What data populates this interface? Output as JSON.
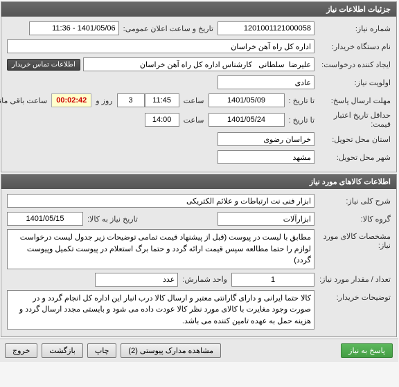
{
  "panel1": {
    "title": "جزئیات اطلاعات نیاز",
    "need_number_label": "شماره نیاز:",
    "need_number": "1201001121000058",
    "announce_label": "تاریخ و ساعت اعلان عمومی:",
    "announce_value": "1401/05/06 - 11:36",
    "buyer_label": "نام دستگاه خریدار:",
    "buyer_value": "اداره کل راه آهن خراسان",
    "requester_label": "ایجاد کننده درخواست:",
    "requester_value": "علیرضا  سلطانی   کارشناس اداره کل راه آهن خراسان",
    "contact_btn": "اطلاعات تماس خریدار",
    "priority_label": "اولویت نیاز:",
    "priority_value": "عادی",
    "deadline_label": "مهلت ارسال پاسخ:",
    "to_date_label": "تا تاریخ :",
    "deadline_date": "1401/05/09",
    "time_label": "ساعت",
    "deadline_time": "11:45",
    "days_remaining": "3",
    "days_and_label": "روز و",
    "countdown": "00:02:42",
    "hours_remaining_label": "ساعت باقی مانده",
    "price_validity_label": "حداقل تاریخ اعتبار قیمت:",
    "price_validity_date": "1401/05/24",
    "price_validity_time": "14:00",
    "province_label": "استان محل تحویل:",
    "province_value": "خراسان رضوی",
    "city_label": "شهر محل تحویل:",
    "city_value": "مشهد"
  },
  "panel2": {
    "title": "اطلاعات کالاهای مورد نیاز",
    "desc_label": "شرح کلی نیاز:",
    "desc_value": "ابزار فنی نت ارتباطات و علائم الکتریکی",
    "group_label": "گروه کالا:",
    "group_value": "ابزارآلات",
    "need_date_label": "تاریخ نیاز به کالا:",
    "need_date_value": "1401/05/15",
    "spec_label": "مشخصات کالای مورد نیاز:",
    "spec_value": "مطابق با لیست در پیوست (قبل از پیشنهاد قیمت تمامی توضیحات زیر جدول لیست درخواست لوازم را حتما مطالعه سپس قیمت ارائه گردد و حتما برگ استعلام در پیوست تکمیل وپیوست گردد)",
    "qty_label": "تعداد / مقدار مورد نیاز:",
    "qty_value": "1",
    "unit_label": "واحد شمارش:",
    "unit_value": "عدد",
    "notes_label": "توضیحات خریدار:",
    "notes_value": "کالا حتما ایرانی و دارای گارانتی معتبر و ارسال کالا درب انبار این اداره کل انجام گردد و در صورت وجود مغایرت با کالای مورد نظر کالا عودت داده می شود و بایستی مجدد ارسال گردد و هزینه حمل به عهده تامین کننده می باشد."
  },
  "buttons": {
    "respond": "پاسخ به نیاز",
    "attachments": "مشاهده مدارک پیوستی (2)",
    "print": "چاپ",
    "back": "بازگشت",
    "exit": "خروج"
  }
}
